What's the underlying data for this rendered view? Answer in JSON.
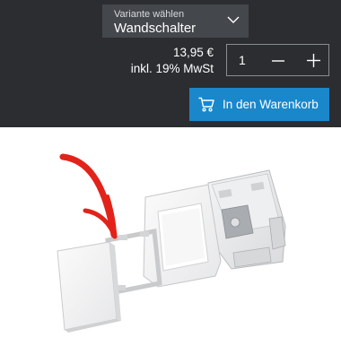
{
  "variant": {
    "label": "Variante wählen",
    "value": "Wandschalter"
  },
  "price": {
    "amount": "13,95 €",
    "tax": "inkl. 19% MwSt"
  },
  "quantity": {
    "value": "1"
  },
  "cart": {
    "label": "In den Warenkorb"
  },
  "colors": {
    "header_bg": "#2b2d30",
    "select_bg": "#44474c",
    "accent": "#1a87cb",
    "annotation_arrow": "#e2231a"
  },
  "icons": [
    "chevron-down-icon",
    "minus-icon",
    "plus-icon",
    "cart-icon"
  ]
}
